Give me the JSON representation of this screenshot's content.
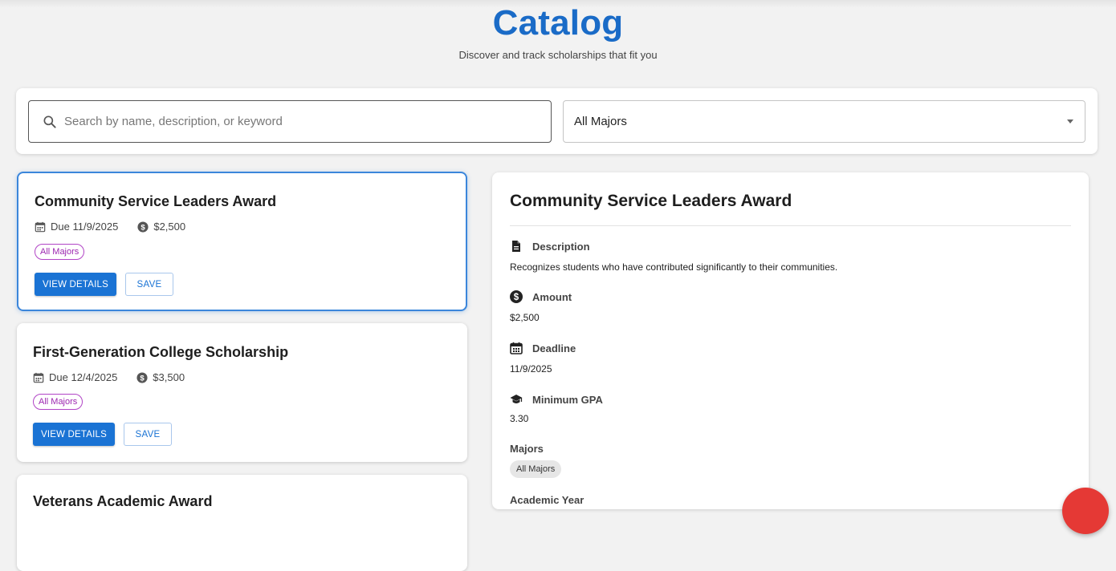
{
  "header": {
    "title": "Catalog",
    "subtitle": "Discover and track scholarships that fit you"
  },
  "filters": {
    "search_placeholder": "Search by name, description, or keyword",
    "search_value": "",
    "major_selected": "All Majors"
  },
  "cards": [
    {
      "title": "Community Service Leaders Award",
      "due": "Due 11/9/2025",
      "amount": "$2,500",
      "major": "All Majors",
      "details_label": "VIEW DETAILS",
      "save_label": "SAVE"
    },
    {
      "title": "First-Generation College Scholarship",
      "due": "Due 12/4/2025",
      "amount": "$3,500",
      "major": "All Majors",
      "details_label": "VIEW DETAILS",
      "save_label": "SAVE"
    },
    {
      "title": "Veterans Academic Award"
    }
  ],
  "detail": {
    "title": "Community Service Leaders Award",
    "description_label": "Description",
    "description": "Recognizes students who have contributed significantly to their communities.",
    "amount_label": "Amount",
    "amount": "$2,500",
    "deadline_label": "Deadline",
    "deadline": "11/9/2025",
    "gpa_label": "Minimum GPA",
    "gpa": "3.30",
    "majors_label": "Majors",
    "majors": [
      "All Majors"
    ],
    "year_label": "Academic Year"
  },
  "colors": {
    "accent": "#1a6bc7",
    "button": "#1a73d4",
    "chip_purple": "#9c27b0",
    "selected_border": "#3b86db",
    "fab": "#e53935"
  }
}
